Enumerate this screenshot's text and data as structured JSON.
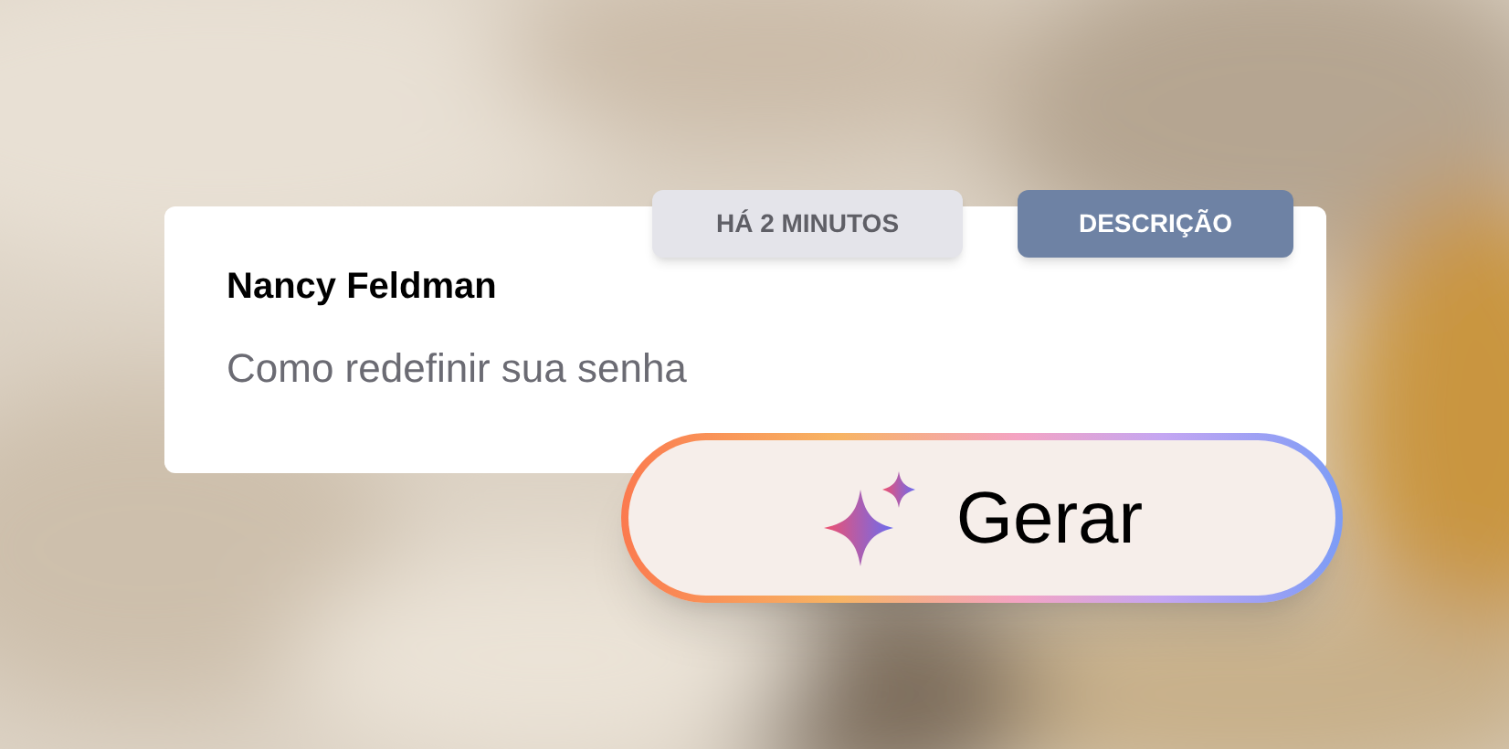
{
  "card": {
    "tags": [
      {
        "kind": "time",
        "label": "HÁ 2 MINUTOS",
        "color": "#e4e4ea"
      },
      {
        "kind": "category",
        "label": "DESCRIÇÃO",
        "color": "#6e82a4"
      }
    ],
    "name": "Nancy Feldman",
    "subject": "Como redefinir sua senha"
  },
  "button": {
    "label": "Gerar"
  }
}
